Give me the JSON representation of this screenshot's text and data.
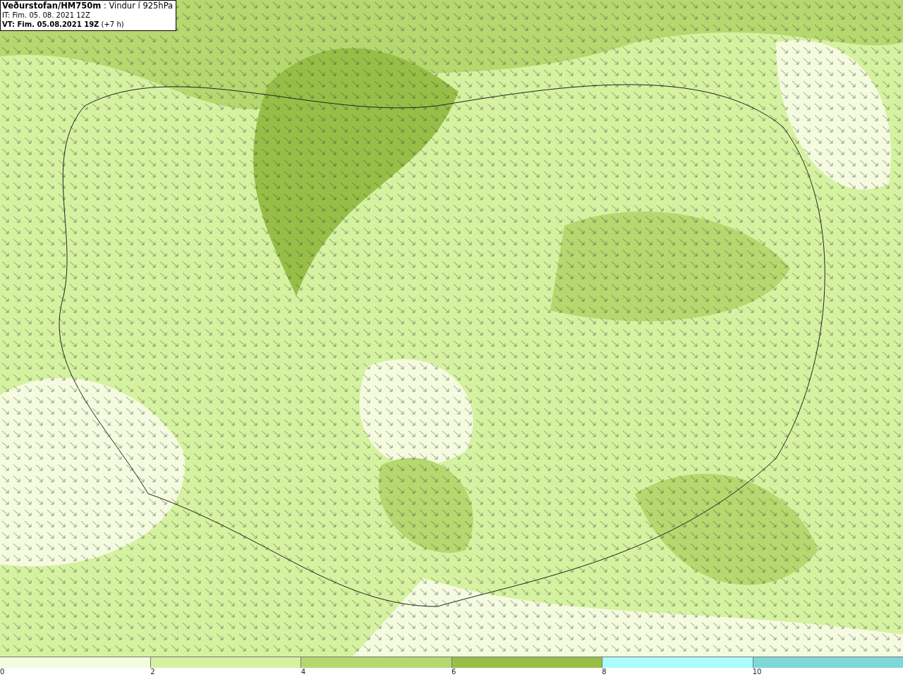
{
  "title_box": {
    "lines": [
      "**Veðurstofan/HM750m** : Vindur í 925hPa",
      "IT: Fim. 05. 08. 2021 12Z",
      "**VT: Fim. 05.08.2021 19Z** (+7 h)"
    ]
  },
  "legend": {
    "bins": [
      {
        "label": "0",
        "color": "#f4fbdf"
      },
      {
        "label": "2",
        "color": "#d5f2a0"
      },
      {
        "label": "4",
        "color": "#b5d86f"
      },
      {
        "label": "6",
        "color": "#97bf47"
      },
      {
        "label": "8",
        "color": "#acfdfd"
      },
      {
        "label": "10",
        "color": "#7ed8d8"
      }
    ]
  }
}
